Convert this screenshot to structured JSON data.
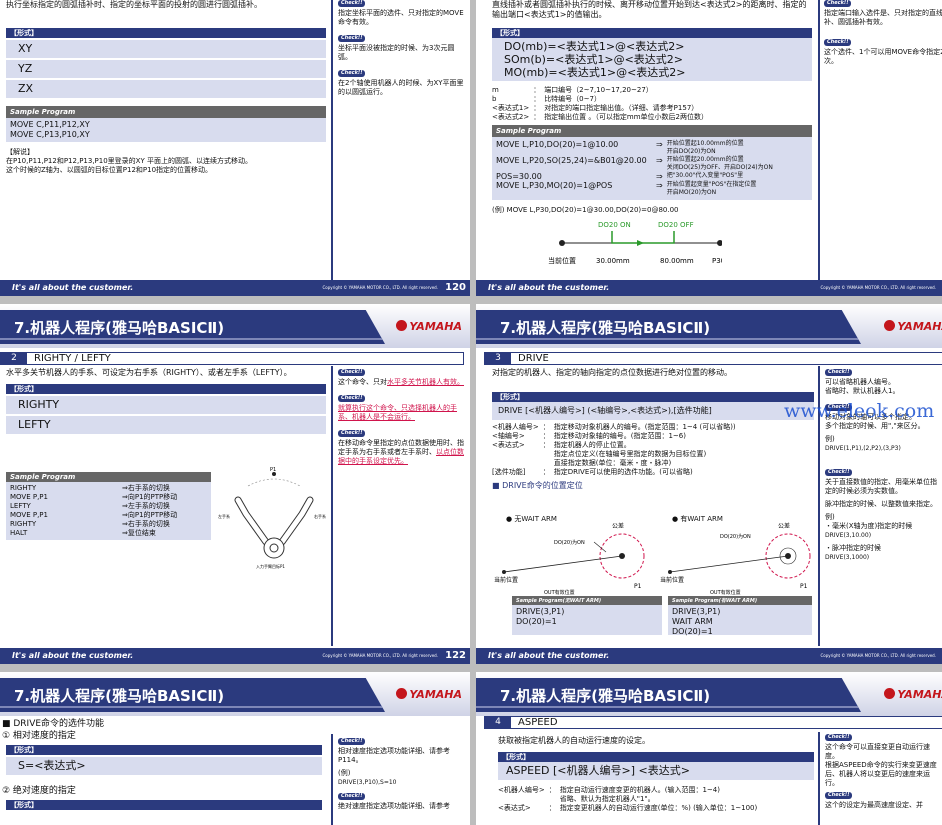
{
  "footer": {
    "slogan": "It's all about the customer.",
    "copyright": "Copyright © YAMAHA MOTOR CO., LTD. All right reserved.",
    "p1": "120",
    "p2": "1",
    "p3": "122",
    "p4": "1"
  },
  "header": {
    "title": "7.机器人程序(雅马哈BASICⅡ)",
    "logo": "YAMAHA"
  },
  "p1": {
    "intro": "执行坐标指定的圆弧插补时、指定的坐标平面的投射的圆进行圆弧插补。",
    "form_label": "【形式】",
    "forms": [
      "XY",
      "YZ",
      "ZX"
    ],
    "sample_label": "Sample Program",
    "sample": [
      "MOVE C,P11,P12,XY",
      "MOVE C,P13,P10,XY"
    ],
    "expl_label": "【解说】",
    "expl": [
      "在P10,P11,P12和P12,P13,P10里登录的XY 平面上的圆弧、以连续方式移动。",
      "这个时候的Z轴为、以圆弧的目标位置P12和P10指定的位置移动。"
    ],
    "check": "Check!!",
    "side": [
      "指定坐标平面的选件、只对指定的MOVE命令有效。",
      "坐标平面没被指定的时候、为3次元圆弧。",
      "在2个轴使用机器人的时候、为XY平面里的以圆弧运行。"
    ]
  },
  "p2": {
    "intro": "直线插补或者圆弧插补执行的时候、离开移动位置开始到达<表达式2>的距离时、指定的输出端口<表达式1>的值输出。",
    "form_label": "【形式】",
    "forms": [
      "DO(mb)=<表达式1>@<表达式2>",
      "SOm(b)=<表达式1>@<表达式2>",
      "MO(mb)=<表达式1>@<表达式2>"
    ],
    "params": [
      [
        "m",
        "：",
        "端口编号（2~7,10~17,20~27）"
      ],
      [
        "b",
        "：",
        "比特编号（0~7）"
      ],
      [
        "<表达式1>",
        "：",
        "对指定的端口指定输出值。（详细、请参考P157）"
      ],
      [
        "<表达式2>",
        "：",
        "指定输出位置 。（可以指定mm单位小数后2两位数）"
      ]
    ],
    "sample_label": "Sample Program",
    "sample": [
      [
        "MOVE L,P10,DO(20)=1@10.00",
        "⇒",
        "开始位置起10.00mm的位置",
        "开启DO(20)为ON"
      ],
      [
        "MOVE L,P20,SO(25,24)=&B01@20.00",
        "⇒",
        "开始位置起20.00mm的位置",
        "关闭DO(25)为OFF、开启DO(24)为ON"
      ],
      [
        "POS=30.00",
        "⇒",
        "把\"30.00\"代入变量\"POS\"里",
        ""
      ],
      [
        "MOVE L,P30,MO(20)=1@POS",
        "⇒",
        "开始位置起变量\"POS\"在指定位置",
        "开启MO(20)为ON"
      ]
    ],
    "example": "(例) MOVE L,P30,DO(20)=1@30.00,DO(20)=0@80.00",
    "diag": {
      "on": "DO20 ON",
      "off": "DO20 OFF",
      "cur": "当前位置",
      "a": "30.00mm",
      "b": "80.00mm",
      "end": "P30"
    },
    "check": "Check!!",
    "side": [
      "指定端口输入选件是、只对指定的直线插补、圆弧插补有效。",
      "这个选件、1个可以用MOVE命令指定2次。"
    ]
  },
  "p3": {
    "sec_num": "2",
    "sec_title": "RIGHTY / LEFTY",
    "intro": "水平多关节机器人的手系、可设定为右手系（RIGHTY）、或者左手系（LEFTY）。",
    "form_label": "【形式】",
    "forms": [
      "RIGHTY",
      "LEFTY"
    ],
    "sample_label": "Sample Program",
    "sample": [
      [
        "RIGHTY",
        "⇒",
        "右手系的切换"
      ],
      [
        "MOVE P,P1",
        "⇒",
        "向P1的PTP移动"
      ],
      [
        "LEFTY",
        "⇒",
        "左手系的切换"
      ],
      [
        "MOVE P,P1",
        "⇒",
        "向P1的PTP移动"
      ],
      [
        "RIGHTY",
        "⇒",
        "右手系的切换"
      ],
      [
        "HALT",
        "⇒",
        "复位结束"
      ]
    ],
    "robot": {
      "p1": "P1",
      "r": "右手系",
      "l": "左手系",
      "cap": "入力手臂目标P1"
    },
    "check": "Check!!",
    "side1a": "这个命令、只对",
    "side1b": "水平多关节机器人有效。",
    "side2a": "",
    "side2b": "就算执行这个命令、只选择机器人的手系、机器人是不会运行。",
    "side3a": "在移动命令里指定的点位数据使用时、指定手系为右手系或者左手系时、",
    "side3b": "以点位数据中的手系设定优先。"
  },
  "p4": {
    "sec_num": "3",
    "sec_title": "DRIVE",
    "intro": "对指定的机器人、指定的轴向指定的点位数据进行绝对位置的移动。",
    "form_label": "【形式】",
    "form": "DRIVE [<机器人编号>] (<轴编号>,<表达式>),[选件功能]",
    "params": [
      [
        "<机器人编号>",
        "：",
        "指定移动对象机器人的编号。(指定范围：1~4 (可以省略))"
      ],
      [
        "<轴编号>",
        "：",
        "指定移动对象轴的编号。(指定范围：1~6)"
      ],
      [
        "<表达式>",
        "：",
        "指定机器人的停止位置。"
      ],
      [
        "",
        "",
        "指定点位定义(在轴编号里指定的数据为目标位置)"
      ],
      [
        "",
        "",
        "直接指定数据(单位：毫米・度・脉冲)"
      ],
      [
        "[选件功能]",
        "：",
        "指定DRIVE可以使用的选件功能。(可以省略)"
      ]
    ],
    "pos_title": "■ DRIVE命令的位置定位",
    "case1": "● 无WAIT ARM",
    "case2": "● 有WAIT ARM",
    "diag": {
      "tol": "公差",
      "do": "DO(20)为ON",
      "cur": "当前位置",
      "out": "OUT有效位置",
      "p1": "P1"
    },
    "s1_label": "Sample Program(无WAIT ARM)",
    "s1": [
      "DRIVE(3,P1)",
      "DO(20)=1"
    ],
    "s2_label": "Sample Program(有WAIT ARM)",
    "s2": [
      "DRIVE(3,P1)",
      "WAIT ARM",
      "DO(20)=1"
    ],
    "check": "Check!!",
    "side1": [
      "可以省略机器人编号。",
      "省略时、默认机器人1。"
    ],
    "side2": [
      "移动对象的轴可以多个指定。",
      "多个指定的时候、用\",\"来区分。",
      "例)",
      "DRIVE(1,P1),(2,P2),(3,P3)"
    ],
    "side3": [
      "关于直接数值的指定、用毫米单位指定的时候必须为实数值。",
      "脉冲指定的时候、以整数值来指定。",
      "例)",
      "・毫米(X轴为度)指定的时候",
      "DRIVE(3,10.00)",
      "・脉冲指定的时候",
      "DRIVE(3,1000)"
    ],
    "watermark": "www.eleok.com"
  },
  "p5": {
    "title": "■ DRIVE命令的选件功能",
    "sub1": "① 相对速度的指定",
    "form_label": "【形式】",
    "form1": "S=<表达式>",
    "sub2": "② 绝对速度的指定",
    "check": "Check!!",
    "side1": [
      "相对速度指定选项功能详细、请参考P114。",
      "(例)",
      "DRIVE(3,P10),S=10"
    ],
    "side2": "绝对速度指定选项功能详细、请参考"
  },
  "p6": {
    "sec_num": "4",
    "sec_title": "ASPEED",
    "intro": "获取被指定机器人的自动运行速度的设定。",
    "form_label": "【形式】",
    "form": "ASPEED [<机器人编号>] <表达式>",
    "params": [
      [
        "<机器人编号>",
        "：",
        "指定自动运行速度变更的机器人。(输入范围：1~4)"
      ],
      [
        "",
        "",
        "省略、默认为指定机器人\"1\"。"
      ],
      [
        "<表达式>",
        "：",
        "指定变更机器人的自动运行速度(单位：%)  (输入单位：1~100)"
      ]
    ],
    "check": "Check!!",
    "side1": [
      "这个命令可以直接变更自动运行速度。",
      "根据ASPEED命令的实行来变更速度后、机器人将以变更后的速度来运行。"
    ],
    "side2": "这个的设定为最高速度设定、并"
  }
}
